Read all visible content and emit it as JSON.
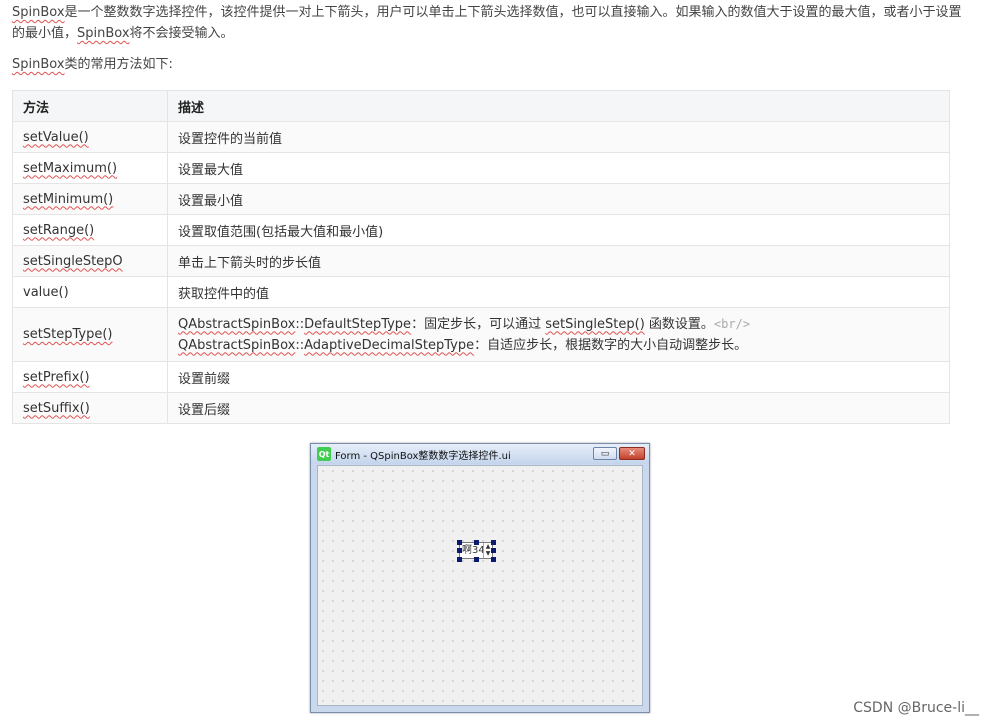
{
  "intro": {
    "p1_term": "SpinBox",
    "p1_text_a": "是一个整数数字选择控件，该控件提供一对上下箭头，用户可以单击上下箭头选择数值，也可以直接输入。如果输入的数值大于设置的最大值，或者小于设置的最小值，",
    "p1_term2": "SpinBox",
    "p1_text_b": "将不会接受输入。",
    "p2_term": "SpinBox",
    "p2_text": "类的常用方法如下:"
  },
  "table": {
    "headers": [
      "方法",
      "描述"
    ],
    "rows": [
      {
        "method": "setValue()",
        "desc": "设置控件的当前值"
      },
      {
        "method": "setMaximum()",
        "desc": "设置最大值"
      },
      {
        "method": "setMinimum()",
        "desc": "设置最小值"
      },
      {
        "method": "setRange()",
        "desc": "设置取值范围(包括最大值和最小值)"
      },
      {
        "method": "setSingleStepO",
        "desc": "单击上下箭头时的步长值"
      },
      {
        "method": "value()",
        "desc": "获取控件中的值"
      },
      {
        "method": "setPrefix()",
        "desc": "设置前缀"
      },
      {
        "method": "setSuffix()",
        "desc": "设置后缀"
      }
    ],
    "steptype": {
      "method": "setStepType()",
      "line1_cls": "QAbstractSpinBox",
      "line1_sep": "::",
      "line1_enum": "DefaultStepType",
      "line1_text": "：固定步长，可以通过 ",
      "line1_fn": "setSingleStep()",
      "line1_end": " 函数设置。",
      "line1_tag": "<br/>",
      "line2_cls": "QAbstractSpinBox",
      "line2_sep": "::",
      "line2_enum": "AdaptiveDecimalStepType",
      "line2_text": "：自适应步长，根据数字的大小自动调整步长。"
    }
  },
  "qt_window": {
    "logo": "Qt",
    "title": "Form - QSpinBox整数数字选择控件.ui",
    "min_glyph": "▭",
    "close_glyph": "✕",
    "spin_value": "啊34",
    "spin_up": "▲",
    "spin_down": "▼"
  },
  "watermark": "CSDN @Bruce-li__"
}
